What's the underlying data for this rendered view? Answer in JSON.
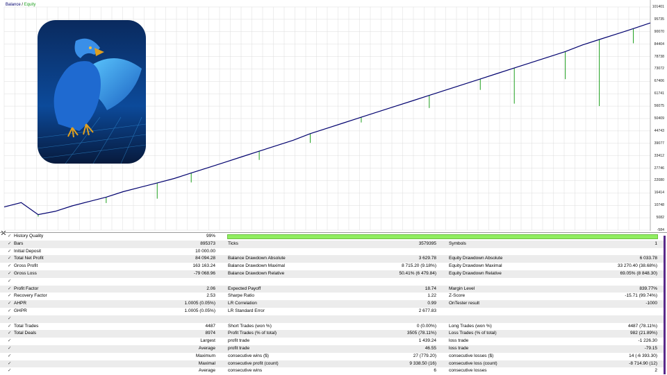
{
  "chart": {
    "legend": {
      "balance": "Balance",
      "separator": "/",
      "equity": "Equity"
    },
    "colors": {
      "balance": "#00006e",
      "equity": "#1ea01e",
      "grid": "#dcdcdc"
    },
    "y_ticks": [
      "101401",
      "95735",
      "90070",
      "84404",
      "78738",
      "73072",
      "67406",
      "61741",
      "56075",
      "50409",
      "44743",
      "39077",
      "33412",
      "27746",
      "22080",
      "16414",
      "10748",
      "5082",
      "-584"
    ]
  },
  "chart_data": {
    "type": "line",
    "title": "",
    "xlabel": "",
    "ylabel": "",
    "ylim": [
      -584,
      101401
    ],
    "series": [
      {
        "name": "Balance",
        "values": [
          10000,
          12000,
          6500,
          8000,
          10500,
          12500,
          14500,
          17000,
          19000,
          21000,
          23000,
          25500,
          28000,
          30500,
          33000,
          35500,
          38000,
          40500,
          43500,
          46000,
          48500,
          51000,
          53500,
          56000,
          58500,
          61000,
          63500,
          66000,
          68500,
          71000,
          73500,
          76000,
          78500,
          81000,
          84000,
          86500,
          89000,
          91500,
          94094
        ]
      },
      {
        "name": "Equity",
        "dips": [
          {
            "i": 2,
            "v": 5600
          },
          {
            "i": 6,
            "v": 11800
          },
          {
            "i": 9,
            "v": 13800
          },
          {
            "i": 11,
            "v": 21200
          },
          {
            "i": 15,
            "v": 31500
          },
          {
            "i": 18,
            "v": 39300
          },
          {
            "i": 21,
            "v": 48600
          },
          {
            "i": 25,
            "v": 55200
          },
          {
            "i": 28,
            "v": 63500
          },
          {
            "i": 30,
            "v": 57200
          },
          {
            "i": 33,
            "v": 68400
          },
          {
            "i": 35,
            "v": 56100
          },
          {
            "i": 37,
            "v": 84800
          }
        ]
      }
    ]
  },
  "report": {
    "history_quality": {
      "label": "History Quality",
      "value": "99%"
    },
    "rows": [
      {
        "c1l": "Bars",
        "c1v": "895373",
        "c2l": "Ticks",
        "c2v": "3579395",
        "c3l": "Symbols",
        "c3v": "1"
      },
      {
        "c1l": "Initial Deposit",
        "c1v": "10 000.00",
        "c2l": "",
        "c2v": "",
        "c3l": "",
        "c3v": ""
      },
      {
        "c1l": "Total Net Profit",
        "c1v": "84 094.28",
        "c2l": "Balance Drawdown Absolute",
        "c2v": "3 629.78",
        "c3l": "Equity Drawdown Absolute",
        "c3v": "6 033.78"
      },
      {
        "c1l": "Gross Profit",
        "c1v": "163 163.24",
        "c2l": "Balance Drawdown Maximal",
        "c2v": "8 715.20 (9.18%)",
        "c3l": "Equity Drawdown Maximal",
        "c3v": "33 270.40 (38.68%)"
      },
      {
        "c1l": "Gross Loss",
        "c1v": "-79 068.96",
        "c2l": "Balance Drawdown Relative",
        "c2v": "50.41% (6 479.84)",
        "c3l": "Equity Drawdown Relative",
        "c3v": "69.05% (8 848.30)"
      },
      {
        "c1l": "",
        "c1v": "",
        "c2l": "",
        "c2v": "",
        "c3l": "",
        "c3v": ""
      },
      {
        "c1l": "Profit Factor",
        "c1v": "2.06",
        "c2l": "Expected Payoff",
        "c2v": "18.74",
        "c3l": "Margin Level",
        "c3v": "839.77%"
      },
      {
        "c1l": "Recovery Factor",
        "c1v": "2.53",
        "c2l": "Sharpe Ratio",
        "c2v": "1.22",
        "c3l": "Z-Score",
        "c3v": "-15.71 (99.74%)"
      },
      {
        "c1l": "AHPR",
        "c1v": "1.0005 (0.05%)",
        "c2l": "LR Correlation",
        "c2v": "0.99",
        "c3l": "OnTester result",
        "c3v": "-1000"
      },
      {
        "c1l": "GHPR",
        "c1v": "1.0005 (0.05%)",
        "c2l": "LR Standard Error",
        "c2v": "2 677.83",
        "c3l": "",
        "c3v": ""
      },
      {
        "c1l": "",
        "c1v": "",
        "c2l": "",
        "c2v": "",
        "c3l": "",
        "c3v": ""
      },
      {
        "c1l": "Total Trades",
        "c1v": "4487",
        "c2l": "Short Trades (won %)",
        "c2v": "0 (0.00%)",
        "c3l": "Long Trades (won %)",
        "c3v": "4487 (78.11%)"
      },
      {
        "c1l": "Total Deals",
        "c1v": "8974",
        "c2l": "Profit Trades (% of total)",
        "c2v": "3505 (78.11%)",
        "c3l": "Loss Trades (% of total)",
        "c3v": "982 (21.89%)"
      },
      {
        "c1r": "Largest",
        "c1v": "",
        "c2l": "profit trade",
        "c2v": "1 439.24",
        "c3l": "loss trade",
        "c3v": "-1 226.30"
      },
      {
        "c1r": "Average",
        "c1v": "",
        "c2l": "profit trade",
        "c2v": "46.55",
        "c3l": "loss trade",
        "c3v": "-79.15"
      },
      {
        "c1r": "Maximum",
        "c1v": "",
        "c2l": "consecutive wins ($)",
        "c2v": "27 (779.20)",
        "c3l": "consecutive losses ($)",
        "c3v": "14 (-6 393.30)"
      },
      {
        "c1r": "Maximal",
        "c1v": "",
        "c2l": "consecutive profit (count)",
        "c2v": "9 338.50 (16)",
        "c3l": "consecutive loss (count)",
        "c3v": "-8 714.90 (12)"
      },
      {
        "c1r": "Average",
        "c1v": "",
        "c2l": "consecutive wins",
        "c2v": "6",
        "c3l": "consecutive losses",
        "c3v": "2"
      }
    ]
  }
}
